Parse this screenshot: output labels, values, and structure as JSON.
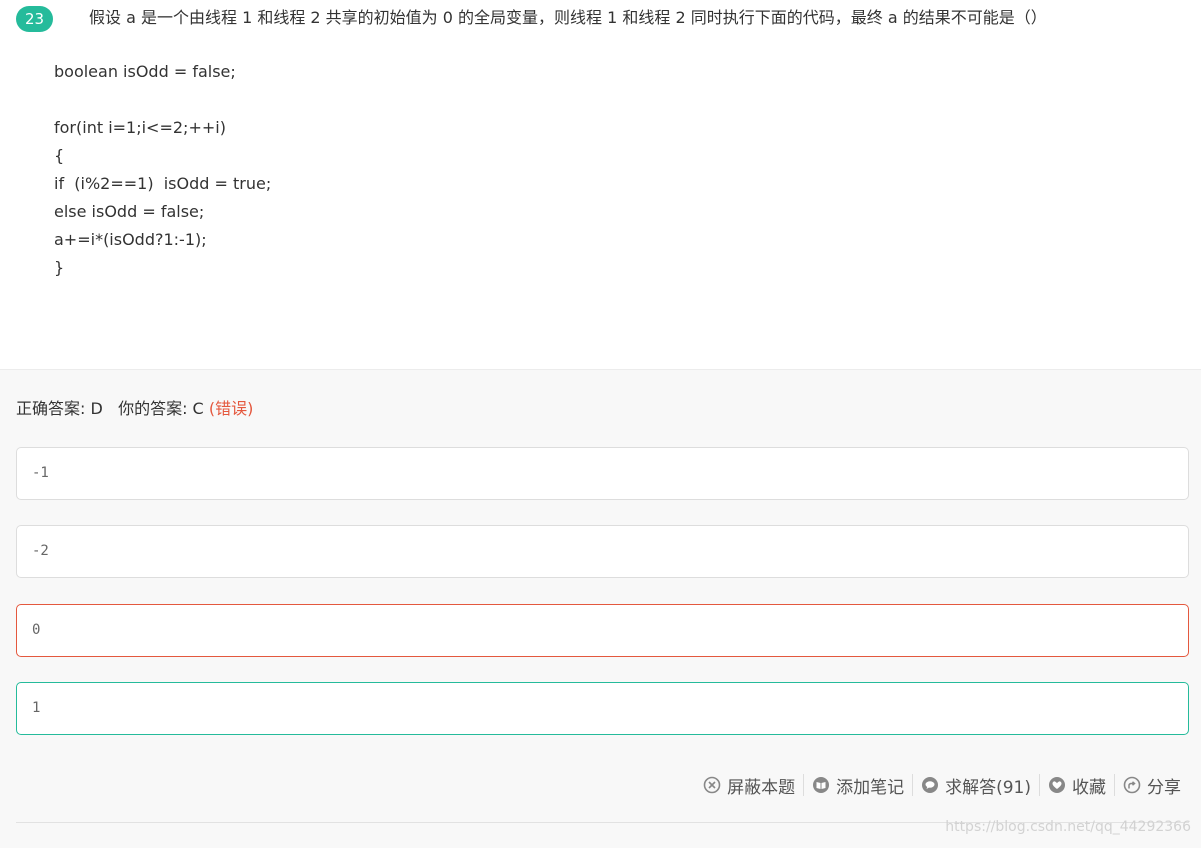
{
  "question": {
    "number": "23",
    "text": "假设 a 是一个由线程 1 和线程 2 共享的初始值为 0 的全局变量，则线程 1 和线程 2 同时执行下面的代码，最终 a 的结果不可能是（）",
    "code_lines": [
      "boolean isOdd = false;",
      "",
      "for(int i=1;i<=2;++i)",
      "{",
      "if  (i%2==1)  isOdd = true;",
      "else isOdd = false;",
      "a+=i*(isOdd?1:-1);",
      "}"
    ]
  },
  "result": {
    "correct_label": "正确答案: D",
    "your_label": "你的答案: C",
    "wrong_mark": "(错误)",
    "colors": {
      "wrong": "#e4583e",
      "correct": "#25bb9b"
    }
  },
  "options": [
    {
      "text": "-1",
      "state": "normal"
    },
    {
      "text": "-2",
      "state": "normal"
    },
    {
      "text": "0",
      "state": "wrong"
    },
    {
      "text": "1",
      "state": "correct"
    }
  ],
  "actions": [
    {
      "label": "屏蔽本题",
      "icon": "close-circle-icon"
    },
    {
      "label": "添加笔记",
      "icon": "notebook-icon"
    },
    {
      "label": "求解答(91)",
      "icon": "chat-bubble-icon"
    },
    {
      "label": "收藏",
      "icon": "heart-icon"
    },
    {
      "label": "分享",
      "icon": "share-icon"
    }
  ],
  "watermark": "https://blog.csdn.net/qq_44292366"
}
